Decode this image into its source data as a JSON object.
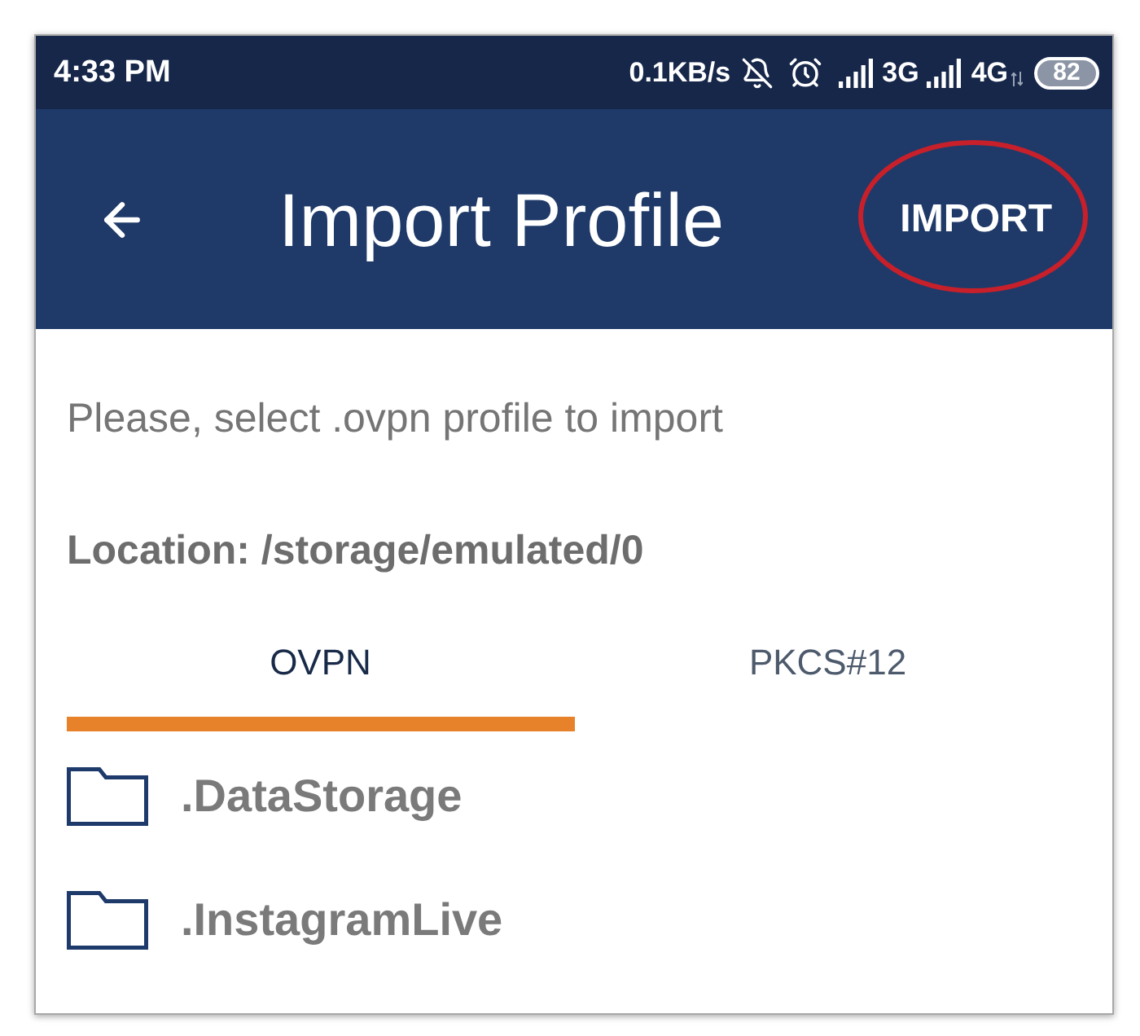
{
  "status_bar": {
    "time": "4:33 PM",
    "net_speed": "0.1KB/s",
    "network_1": "3G",
    "network_2": "4G",
    "battery": "82"
  },
  "header": {
    "title": "Import Profile",
    "action": {
      "label": "IMPORT",
      "highlighted": true
    }
  },
  "prompt": "Please, select .ovpn profile to import",
  "location": "Location: /storage/emulated/0",
  "tabs": [
    {
      "label": "OVPN",
      "selected": true
    },
    {
      "label": "PKCS#12",
      "selected": false
    }
  ],
  "files": [
    {
      "name": ".DataStorage"
    },
    {
      "name": ".InstagramLive"
    }
  ]
}
